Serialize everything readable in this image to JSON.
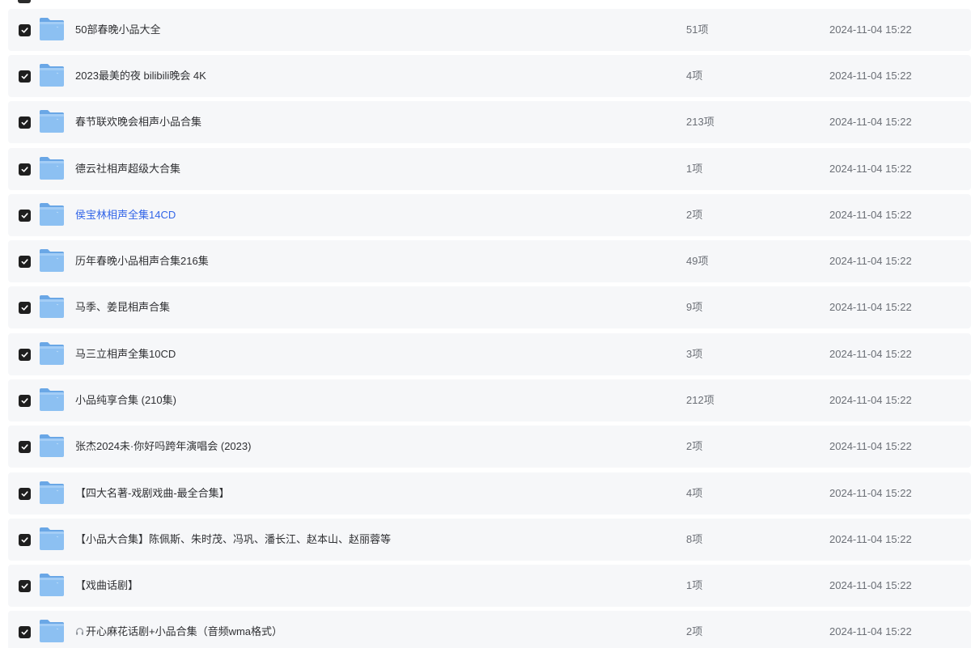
{
  "colors": {
    "row_background": "#f6f7f9",
    "checkbox": "#1f1f1f",
    "folder_blue": "#7fb6ee",
    "link_blue": "#3366e8",
    "text": "#2f3033",
    "muted": "#6b6f76"
  },
  "rows": [
    {
      "name": "50部春晚小品大全",
      "count": "51项",
      "date": "2024-11-04 15:22",
      "checked": true,
      "icon": "folder-icon"
    },
    {
      "name": "2023最美的夜 bilibili晚会 4K",
      "count": "4项",
      "date": "2024-11-04 15:22",
      "checked": true,
      "icon": "folder-icon"
    },
    {
      "name": "春节联欢晚会相声小品合集",
      "count": "213项",
      "date": "2024-11-04 15:22",
      "checked": true,
      "icon": "folder-icon"
    },
    {
      "name": "德云社相声超级大合集",
      "count": "1项",
      "date": "2024-11-04 15:22",
      "checked": true,
      "icon": "folder-icon"
    },
    {
      "name": "侯宝林相声全集14CD",
      "count": "2项",
      "date": "2024-11-04 15:22",
      "checked": true,
      "icon": "folder-icon",
      "highlight": true
    },
    {
      "name": "历年春晚小品相声合集216集",
      "count": "49项",
      "date": "2024-11-04 15:22",
      "checked": true,
      "icon": "folder-icon"
    },
    {
      "name": "马季、姜昆相声合集",
      "count": "9项",
      "date": "2024-11-04 15:22",
      "checked": true,
      "icon": "folder-icon"
    },
    {
      "name": "马三立相声全集10CD",
      "count": "3项",
      "date": "2024-11-04 15:22",
      "checked": true,
      "icon": "folder-icon"
    },
    {
      "name": "小品纯享合集 (210集)",
      "count": "212项",
      "date": "2024-11-04 15:22",
      "checked": true,
      "icon": "folder-icon"
    },
    {
      "name": "张杰2024未·你好吗跨年演唱会 (2023)",
      "count": "2项",
      "date": "2024-11-04 15:22",
      "checked": true,
      "icon": "folder-icon"
    },
    {
      "name": "【四大名著-戏剧戏曲-最全合集】",
      "count": "4项",
      "date": "2024-11-04 15:22",
      "checked": true,
      "icon": "folder-icon"
    },
    {
      "name": "【小品大合集】陈佩斯、朱时茂、冯巩、潘长江、赵本山、赵丽蓉等",
      "count": "8项",
      "date": "2024-11-04 15:22",
      "checked": true,
      "icon": "folder-icon"
    },
    {
      "name": "【戏曲话剧】",
      "count": "1项",
      "date": "2024-11-04 15:22",
      "checked": true,
      "icon": "folder-icon"
    },
    {
      "name": "开心麻花话剧+小品合集（音频wma格式）",
      "count": "2项",
      "date": "2024-11-04 15:22",
      "checked": true,
      "icon": "folder-icon",
      "prefix_icon": "headphone-icon"
    }
  ]
}
